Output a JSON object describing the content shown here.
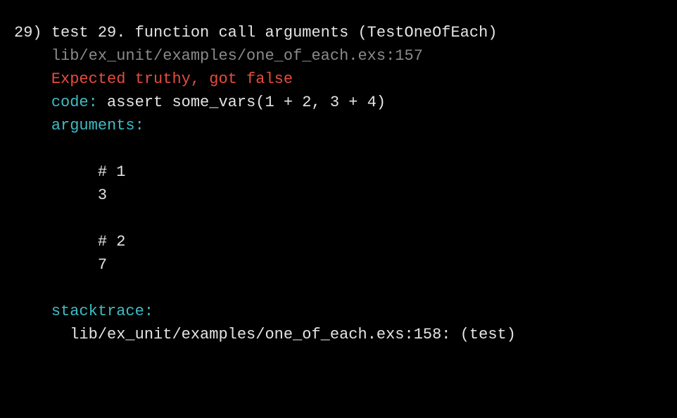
{
  "testNumber": "29)",
  "testTitle": "test 29. function call arguments (TestOneOfEach)",
  "fileLocation": "lib/ex_unit/examples/one_of_each.exs:157",
  "errorMessage": "Expected truthy, got false",
  "codeLabel": "code:",
  "codeValue": " assert some_vars(1 + 2, 3 + 4)",
  "argumentsLabel": "arguments:",
  "arg1Label": "# 1",
  "arg1Value": "3",
  "arg2Label": "# 2",
  "arg2Value": "7",
  "stacktraceLabel": "stacktrace:",
  "stacktraceValue": "lib/ex_unit/examples/one_of_each.exs:158: (test)"
}
